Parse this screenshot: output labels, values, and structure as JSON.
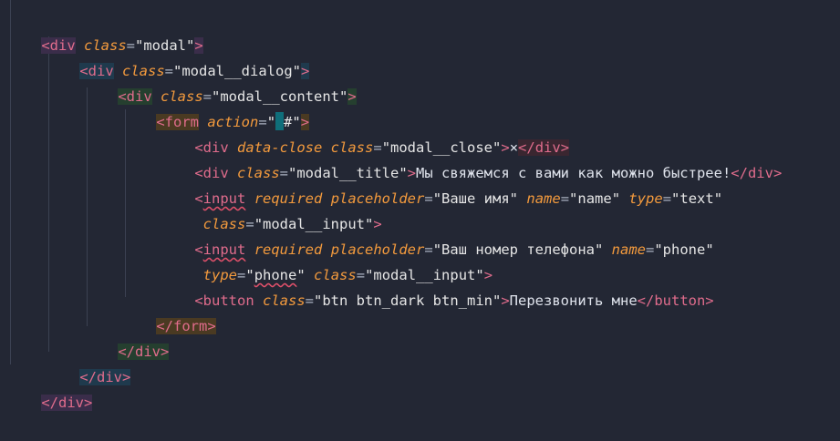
{
  "editor": {
    "lines": [
      [
        "<div ",
        "class",
        "=\"modal\">"
      ],
      [
        "<div ",
        "class",
        "=\"modal__dialog\">"
      ],
      [
        "<div ",
        "class",
        "=\"modal__content\">"
      ],
      [
        "<form ",
        "action",
        "=\"#\">"
      ],
      [
        "<div ",
        "data-close",
        " ",
        "class",
        "=\"modal__close\">×</div>"
      ],
      [
        "<div ",
        "class",
        "=\"modal__title\">Мы свяжемся с вами как можно быстрее!</div>"
      ],
      [
        "<",
        "input",
        " ",
        "required",
        " ",
        "placeholder",
        "=\"Ваше имя\" ",
        "name",
        "=\"name\" ",
        "type",
        "=\"text\""
      ],
      [
        " ",
        "class",
        "=\"modal__input\">"
      ],
      [
        "<",
        "input",
        " ",
        "required",
        " ",
        "placeholder",
        "=\"Ваш номер телефона\" ",
        "name",
        "=\"phone\""
      ],
      [
        " ",
        "type",
        "=\"phone\" ",
        "class",
        "=\"modal__input\">"
      ],
      [
        "<button ",
        "class",
        "=\"btn btn_dark btn_min\">Перезвонить мне</button>"
      ],
      [
        "</form>"
      ],
      [
        "</div>"
      ],
      [
        "</div>"
      ],
      [
        "</div>"
      ]
    ],
    "accent_colors": {
      "background": "#232734",
      "tag": "#e06c8c",
      "attribute": "#f39a3d",
      "string": "#e6e6e6"
    }
  }
}
